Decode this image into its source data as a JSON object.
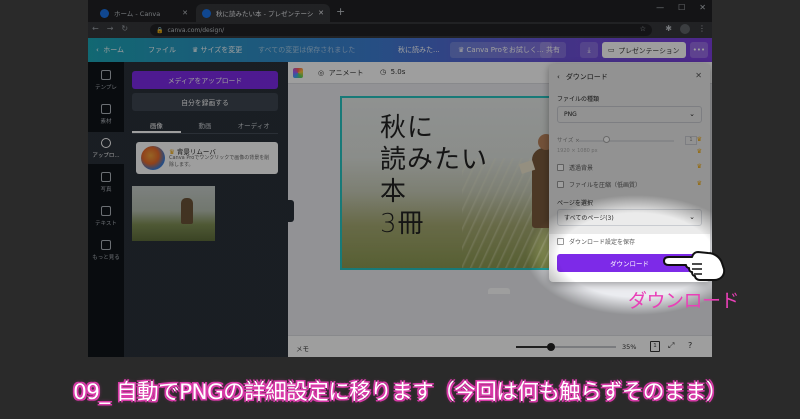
{
  "browser": {
    "tabs": [
      {
        "label": "ホーム - Canva",
        "active": false
      },
      {
        "label": "秋に読みたい本 - プレゼンテーション",
        "active": true
      }
    ],
    "url": "canva.com/design/"
  },
  "header": {
    "home": "ホーム",
    "file": "ファイル",
    "resize": "サイズを変更",
    "saved": "すべての変更は保存されました",
    "doc_title": "秋に読みた...",
    "try_pro": "Canva Proをお試しく...",
    "share": "共有",
    "present": "プレゼンテーション"
  },
  "rail": [
    {
      "label": "テンプレ",
      "icon": "template-icon"
    },
    {
      "label": "素材",
      "icon": "elements-icon"
    },
    {
      "label": "アップロ...",
      "icon": "upload-icon",
      "active": true
    },
    {
      "label": "写真",
      "icon": "photo-icon"
    },
    {
      "label": "テキスト",
      "icon": "text-icon"
    },
    {
      "label": "もっと見る",
      "icon": "more-icon"
    }
  ],
  "panel": {
    "upload_button": "メディアをアップロード",
    "record_button": "自分を録画する",
    "tabs": [
      "画像",
      "動画",
      "オーディオ"
    ],
    "promo_title": "背景リムーバ",
    "promo_body": "Canva Proでワンクリックで画像の背景を削除します。"
  },
  "toolbar": {
    "animate": "アニメート",
    "duration": "5.0s"
  },
  "design": {
    "title_lines": [
      "秋に",
      "読みたい",
      "本",
      "3冊"
    ]
  },
  "bottombar": {
    "memo": "メモ",
    "zoom": "35%",
    "page": "1",
    "zoom_fraction": 0.35
  },
  "download": {
    "title": "ダウンロード",
    "file_type_label": "ファイルの種類",
    "file_type_value": "PNG",
    "size_label": "サイズ ×",
    "size_value": "1",
    "dimensions": "1920 × 1080 px",
    "transparent_bg": "透過背景",
    "compress": "ファイルを圧縮（低画質）",
    "pages_label": "ページを選択",
    "pages_value": "すべてのページ(3)",
    "save_settings": "ダウンロード設定を保存",
    "download_button": "ダウンロード"
  },
  "annotation": "ダウンロード",
  "caption": "09_ 自動でPNGの詳細設定に移ります（今回は何も触らずそのまま）",
  "colors": {
    "accent": "#7d2ae8",
    "caption_outline": "#d83aa8",
    "annotation": "#e940b7",
    "selection": "#27c4c2"
  }
}
